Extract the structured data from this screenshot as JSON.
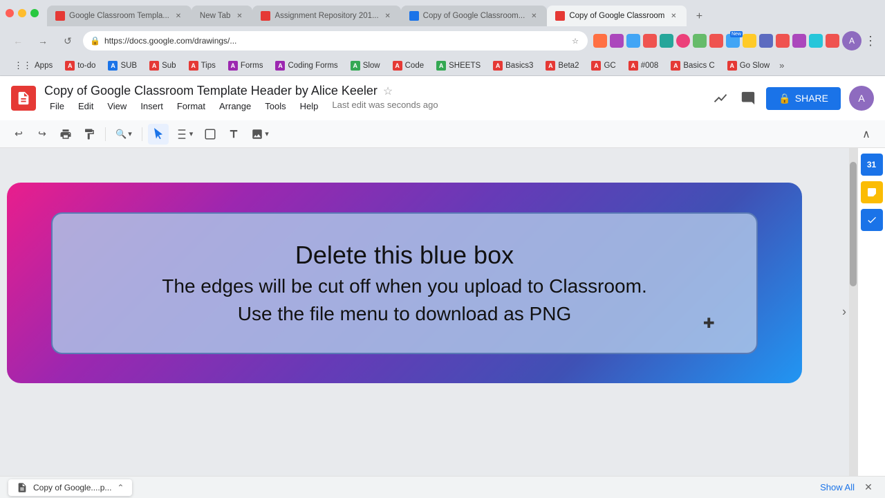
{
  "browser": {
    "tabs": [
      {
        "id": "tab1",
        "label": "Google Classroom Templa...",
        "favicon_color": "red",
        "active": false
      },
      {
        "id": "tab2",
        "label": "New Tab",
        "favicon_color": "none",
        "active": false
      },
      {
        "id": "tab3",
        "label": "Assignment Repository 201...",
        "favicon_color": "red",
        "active": false
      },
      {
        "id": "tab4",
        "label": "Copy of Google Classroom...",
        "favicon_color": "blue",
        "active": false
      },
      {
        "id": "tab5",
        "label": "Copy of Google Classroom",
        "favicon_color": "red",
        "active": true
      }
    ],
    "address": "https://docs.google.com/drawings/...",
    "nav": {
      "back": "←",
      "forward": "→",
      "refresh": "↺",
      "home": "⌂"
    }
  },
  "bookmarks": [
    {
      "label": "Apps",
      "icon": "grid"
    },
    {
      "label": "to-do",
      "color": "#e53935"
    },
    {
      "label": "SUB",
      "color": "#1a73e8"
    },
    {
      "label": "Sub",
      "color": "#e53935"
    },
    {
      "label": "Tips",
      "color": "#e53935"
    },
    {
      "label": "Forms",
      "color": "#9c27b0"
    },
    {
      "label": "Coding Forms",
      "color": "#9c27b0"
    },
    {
      "label": "Slow",
      "color": "#34a853"
    },
    {
      "label": "Code",
      "color": "#e53935"
    },
    {
      "label": "SHEETS",
      "color": "#34a853"
    },
    {
      "label": "Basics3",
      "color": "#e53935"
    },
    {
      "label": "Beta2",
      "color": "#e53935"
    },
    {
      "label": "GC",
      "color": "#e53935"
    },
    {
      "label": "#008",
      "color": "#e53935"
    },
    {
      "label": "Basics C",
      "color": "#e53935"
    },
    {
      "label": "Go Slow",
      "color": "#e53935"
    }
  ],
  "docs": {
    "title": "Copy of Google Classroom Template Header by Alice Keeler",
    "logo_letter": "",
    "menu_items": [
      "File",
      "Edit",
      "View",
      "Insert",
      "Format",
      "Arrange",
      "Tools",
      "Help"
    ],
    "last_edit": "Last edit was seconds ago",
    "share_label": "SHARE",
    "toolbar": {
      "undo": "↩",
      "redo": "↪",
      "print": "🖨",
      "paint": "🪣",
      "zoom": "🔍",
      "select": "↖",
      "line": "╱",
      "shape": "□",
      "text": "T",
      "image": "🖼"
    }
  },
  "canvas": {
    "blue_box": {
      "line1": "Delete this blue box",
      "line2": "The edges will be cut off when you upload to Classroom.",
      "line3": "Use the file menu to download as PNG"
    }
  },
  "bottom_bar": {
    "filename": "Copy of Google....p...",
    "chevron": "⌃",
    "show_all": "Show All",
    "close": "✕"
  },
  "right_sidebar": {
    "calendar_number": "31",
    "icons": [
      "calendar",
      "sticky-note",
      "check-circle"
    ]
  }
}
